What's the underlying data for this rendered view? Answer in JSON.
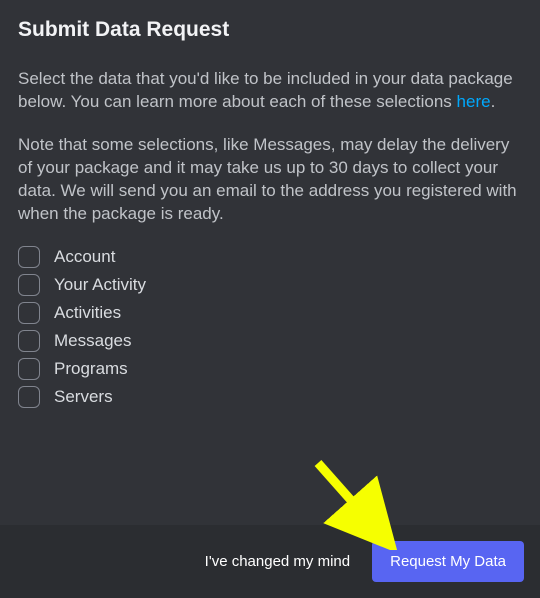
{
  "title": "Submit Data Request",
  "intro_pre": "Select the data that you'd like to be included in your data package below. You can learn more about each of these selections ",
  "intro_link": "here",
  "intro_post": ".",
  "note": "Note that some selections, like Messages, may delay the delivery of your package and it may take us up to 30 days to collect your data. We will send you an email to the address you registered with when the package is ready.",
  "options": {
    "account": "Account",
    "activity": "Your Activity",
    "activities": "Activities",
    "messages": "Messages",
    "programs": "Programs",
    "servers": "Servers"
  },
  "footer": {
    "cancel": "I've changed my mind",
    "submit": "Request My Data"
  }
}
